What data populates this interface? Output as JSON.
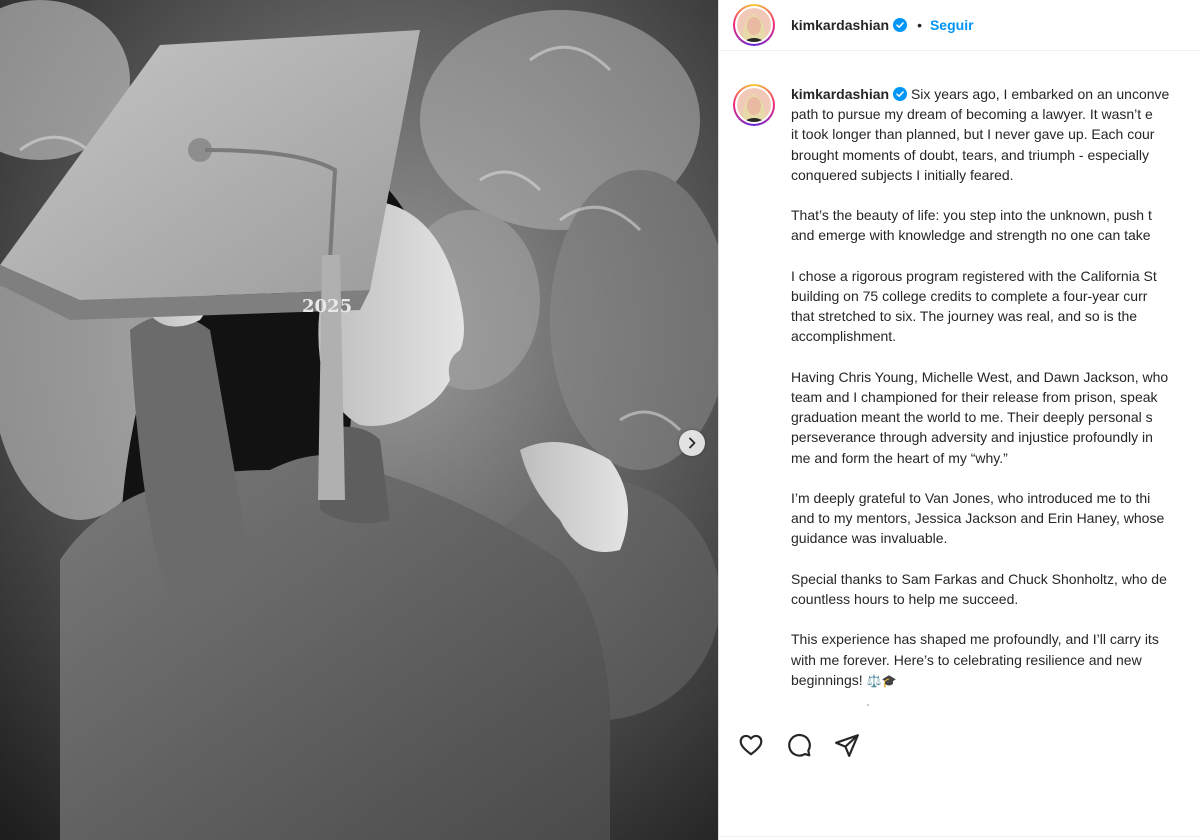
{
  "post": {
    "username": "kimkardashian",
    "follow_label": "Seguir",
    "separator": "•",
    "emoji": "⚖️🎓",
    "caption": [
      [
        "Six years ago, I embarked on an unconve",
        "path to pursue my dream of becoming a lawyer. It wasn’t e",
        "it took longer than planned, but I never gave up. Each cour",
        "brought moments of doubt, tears, and triumph - especially",
        "conquered subjects I initially feared."
      ],
      [
        "That’s the beauty of life: you step into the unknown, push t",
        "and emerge with knowledge and strength no one can take"
      ],
      [
        "I chose a rigorous program registered with the California St",
        "building on 75 college credits to complete a four-year curr",
        "that stretched to six. The journey was real, and so is the",
        "accomplishment."
      ],
      [
        "Having Chris Young, Michelle West, and Dawn Jackson, who",
        "team and I championed for their release from prison, speak",
        "graduation meant the world to me. Their deeply personal s",
        "perseverance through adversity and injustice profoundly in",
        "me and form the heart of my “why.”"
      ],
      [
        "I’m deeply grateful to Van Jones, who introduced me to thi",
        "and to my mentors, Jessica Jackson and Erin Haney, whose",
        "guidance was invaluable."
      ],
      [
        "Special thanks to Sam Farkas and Chuck Shonholtz, who de",
        "countless hours to help me succeed."
      ],
      [
        "This experience has shaped me profoundly, and I’ll carry its",
        "with me forever. Here’s to celebrating resilience and new",
        "beginnings!"
      ]
    ],
    "cap_tassel_text": "2025"
  },
  "icons": {
    "verified": "verified-badge-icon",
    "like": "heart-icon",
    "comment": "comment-icon",
    "share": "share-icon",
    "next": "chevron-right-icon"
  },
  "colors": {
    "accent": "#0095f6",
    "text": "#262626",
    "border": "#dbdbdb"
  }
}
